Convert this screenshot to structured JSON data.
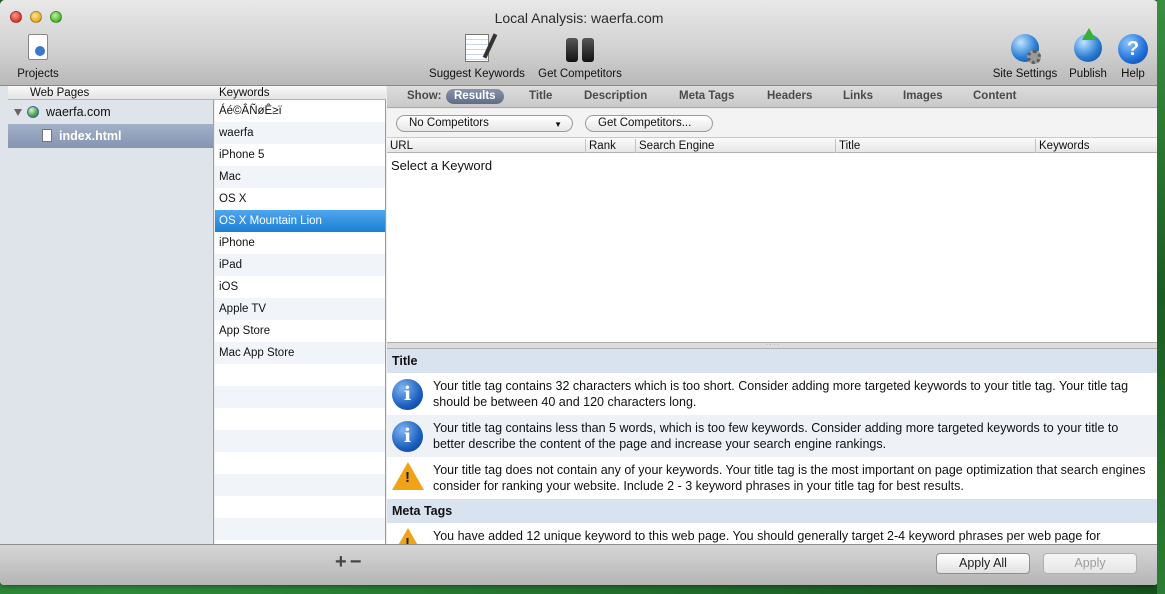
{
  "window": {
    "title": "Local Analysis: waerfa.com"
  },
  "toolbar": {
    "projects": "Projects",
    "suggest_keywords": "Suggest Keywords",
    "get_competitors": "Get Competitors",
    "site_settings": "Site Settings",
    "publish": "Publish",
    "help": "Help"
  },
  "columns": {
    "web_pages": "Web Pages",
    "keywords": "Keywords"
  },
  "tree": {
    "site": "waerfa.com",
    "page": "index.html"
  },
  "keywords": [
    "Áé©ÂÑøÊ≥ï",
    "waerfa",
    "iPhone 5",
    "Mac",
    "OS X",
    "OS X Mountain Lion",
    "iPhone",
    "iPad",
    "iOS",
    "Apple TV",
    "App Store",
    "Mac App Store"
  ],
  "selected_keyword": "OS X Mountain Lion",
  "show_bar": {
    "label": "Show:",
    "tabs": [
      "Results",
      "Title",
      "Description",
      "Meta Tags",
      "Headers",
      "Links",
      "Images",
      "Content"
    ],
    "active": "Results"
  },
  "competitors": {
    "popup": "No Competitors",
    "button": "Get Competitors..."
  },
  "table": {
    "headers": [
      "URL",
      "Rank",
      "Search Engine",
      "Title",
      "Keywords"
    ],
    "empty_text": "Select a Keyword"
  },
  "analysis": {
    "sections": [
      {
        "title": "Title",
        "messages": [
          {
            "icon": "info-icon",
            "text": "Your title tag contains 32 characters which is too short. Consider adding more targeted keywords to your title tag. Your title tag should be between 40 and 120 characters long."
          },
          {
            "icon": "info-icon",
            "text": "Your title tag contains less than 5 words, which is too few keywords. Consider adding more targeted keywords to your title to better describe the content of the page and increase your search engine rankings."
          },
          {
            "icon": "warning-icon",
            "text": "Your title tag does not contain any of your keywords. Your title tag is the most important on page optimization that search engines consider for ranking your website. Include 2 - 3 keyword phrases in your title tag for best results."
          }
        ]
      },
      {
        "title": "Meta Tags",
        "messages": [
          {
            "icon": "warning-icon",
            "text": "You have added 12 unique keyword to this web page. You should generally target 2-4 keyword phrases per web page for"
          }
        ]
      }
    ]
  },
  "bottom": {
    "plus": "+",
    "minus": "−",
    "apply_all": "Apply All",
    "apply": "Apply"
  }
}
